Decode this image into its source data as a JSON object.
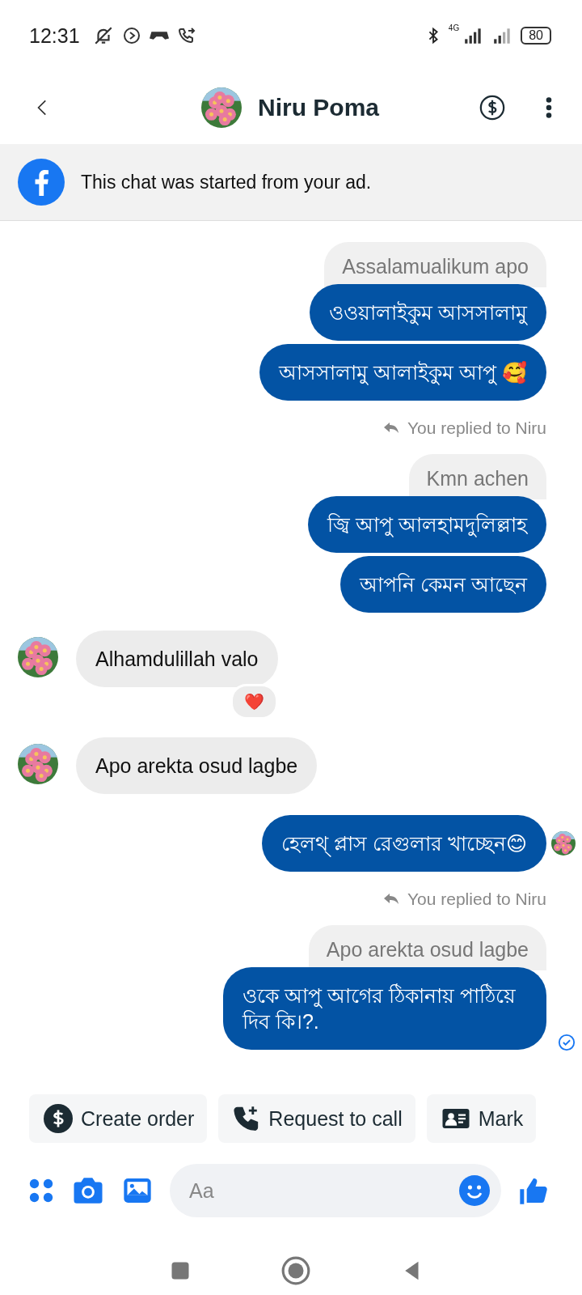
{
  "status_bar": {
    "time": "12:31",
    "network": "4G",
    "battery": "80"
  },
  "header": {
    "name": "Niru Poma"
  },
  "banner": {
    "text": "This chat was started from your ad."
  },
  "messages": [
    {
      "kind": "quote",
      "text": "Assalamualikum apo"
    },
    {
      "kind": "sent",
      "text": "ওওয়ালাইকুম আসসালামু"
    },
    {
      "kind": "sent",
      "text": "আসসালামু আলাইকুম আপু 🥰"
    },
    {
      "kind": "reply_note",
      "text": "You replied to Niru"
    },
    {
      "kind": "quote",
      "text": "Kmn achen"
    },
    {
      "kind": "sent",
      "text": "জ্বি আপু আলহামদুলিল্লাহ"
    },
    {
      "kind": "sent",
      "text": "আপনি কেমন আছেন"
    },
    {
      "kind": "received",
      "text": "Alhamdulillah valo",
      "reaction": "❤️"
    },
    {
      "kind": "received",
      "text": "Apo arekta osud lagbe"
    },
    {
      "kind": "sent",
      "text": "হেলথ্ প্লাস রেগুলার খাচ্ছেন😊",
      "seen": true,
      "delivered": false
    },
    {
      "kind": "reply_note",
      "text": "You replied to Niru"
    },
    {
      "kind": "quote",
      "text": "Apo arekta osud lagbe"
    },
    {
      "kind": "sent",
      "text": "ওকে আপু আগের ঠিকানায় পাঠিয়ে দিব কি।?.",
      "seen": false,
      "delivered": true
    }
  ],
  "quick_actions": [
    {
      "label": "Create order"
    },
    {
      "label": "Request to call"
    },
    {
      "label": "Mark"
    }
  ],
  "composer": {
    "placeholder": "Aa"
  }
}
